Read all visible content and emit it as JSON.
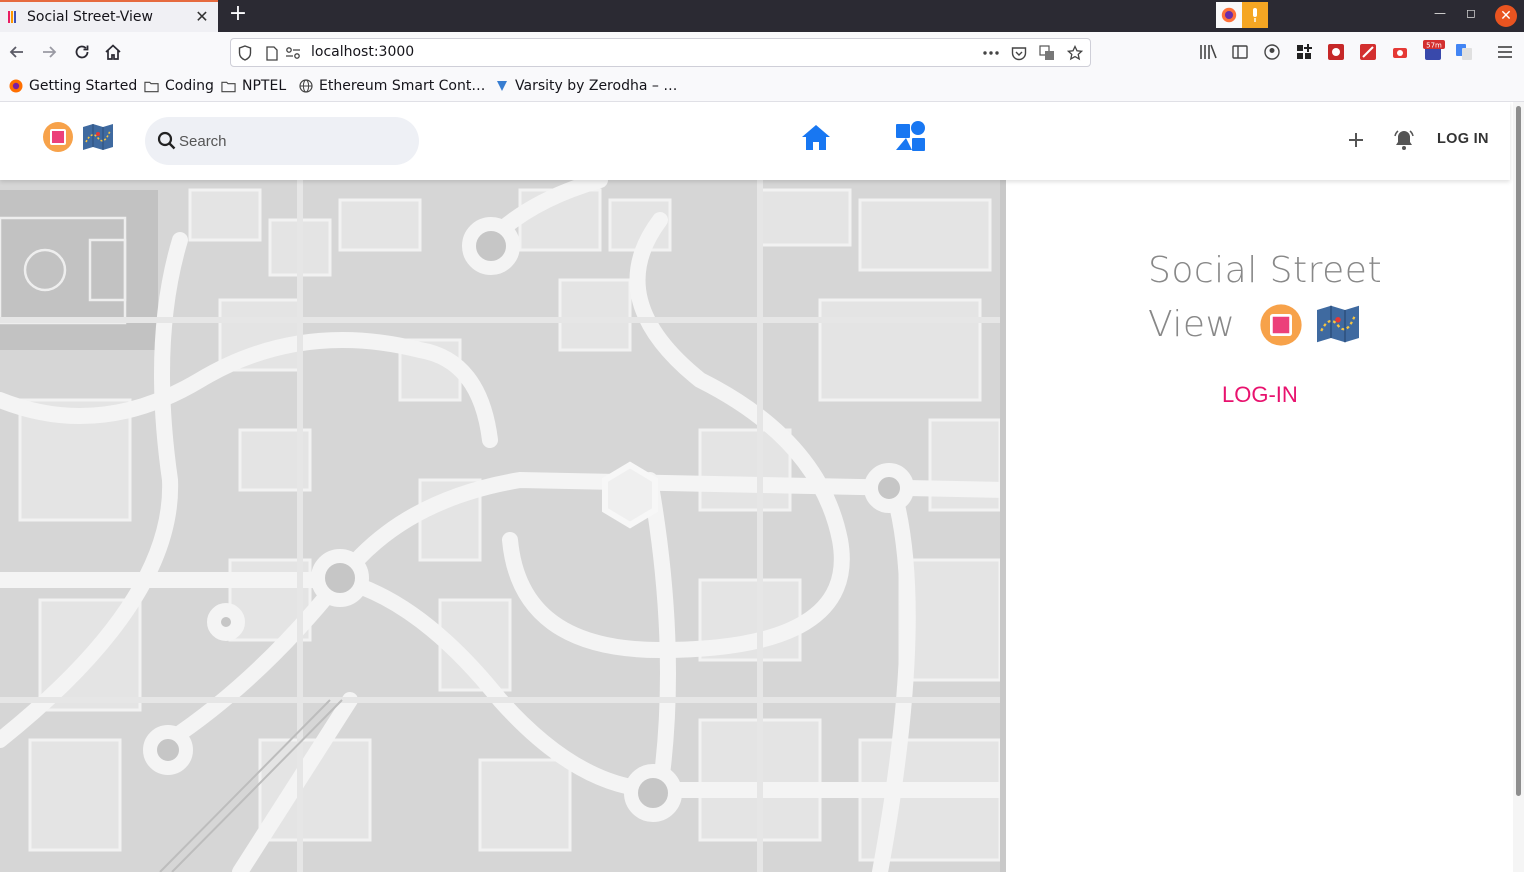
{
  "browser": {
    "tab_title": "Social Street-View",
    "tab_close": "✕",
    "new_tab": "+",
    "url": "localhost:3000",
    "badge_text": "57m",
    "bookmarks": [
      {
        "label": "Getting Started",
        "icon": "firefox-icon"
      },
      {
        "label": "Coding",
        "icon": "folder-icon"
      },
      {
        "label": "NPTEL",
        "icon": "folder-icon"
      },
      {
        "label": "Ethereum Smart Cont…",
        "icon": "globe-icon"
      },
      {
        "label": "Varsity by Zerodha – …",
        "icon": "varsity-icon"
      }
    ]
  },
  "header": {
    "search_placeholder": "Search",
    "login_label": "LOG IN"
  },
  "right": {
    "brand_line1": "Social Street",
    "brand_line2": "View",
    "login_title": "LOG-IN"
  },
  "colors": {
    "accent_blue": "#1877f2",
    "login_pink": "#e8126e",
    "tab_accent": "#e66a3e"
  }
}
